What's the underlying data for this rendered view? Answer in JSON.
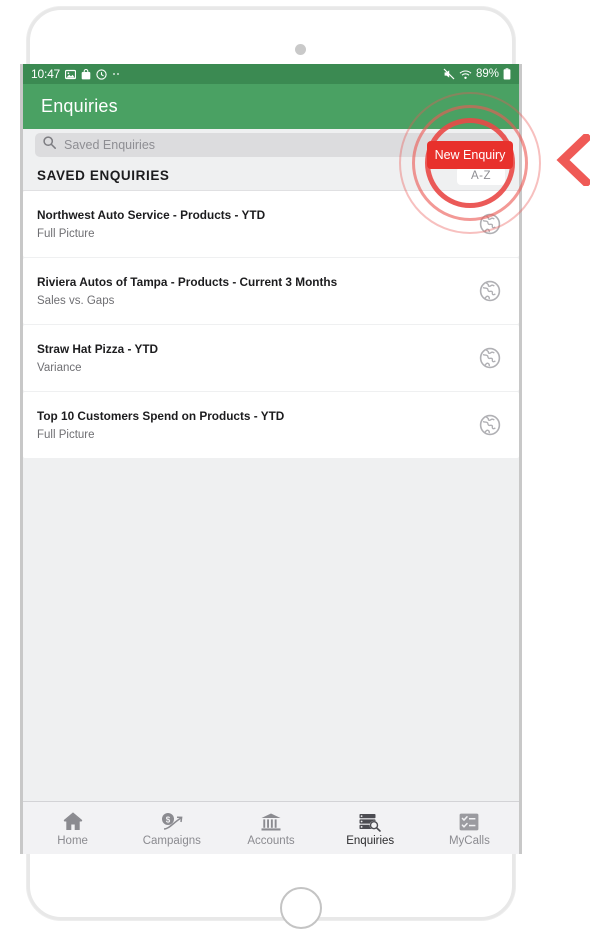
{
  "status_bar": {
    "time": "10:47",
    "left_icons": [
      "image-icon",
      "bag-icon",
      "clock-icon",
      "more-dots-icon"
    ],
    "mute_icon": "mute-icon",
    "wifi_icon": "wifi-icon",
    "battery_percent": "89%",
    "battery_icon": "battery-icon",
    "background_color": "#3b8a52"
  },
  "header": {
    "title": "Enquiries",
    "background_color": "#4aa163"
  },
  "search": {
    "placeholder": "Saved Enquiries",
    "value": "",
    "icon": "search-icon"
  },
  "section": {
    "title": "SAVED ENQUIRIES",
    "sort_label": "A-Z"
  },
  "callout": {
    "button_label": "New Enquiry",
    "button_color": "#e8312c",
    "ring_color": "#eb5a56",
    "arrow_icon": "chevron-left-icon"
  },
  "enquiries": [
    {
      "title": "Northwest Auto Service - Products - YTD",
      "subtitle": "Full Picture",
      "icon": "globe-icon"
    },
    {
      "title": "Riviera Autos of Tampa - Products - Current 3 Months",
      "subtitle": "Sales vs. Gaps",
      "icon": "globe-icon"
    },
    {
      "title": "Straw Hat Pizza - YTD",
      "subtitle": "Variance",
      "icon": "globe-icon"
    },
    {
      "title": "Top 10 Customers Spend on Products - YTD",
      "subtitle": "Full Picture",
      "icon": "globe-icon"
    }
  ],
  "tabs": [
    {
      "label": "Home",
      "icon": "home-icon",
      "active": false
    },
    {
      "label": "Campaigns",
      "icon": "campaign-growth-icon",
      "active": false
    },
    {
      "label": "Accounts",
      "icon": "bank-icon",
      "active": false
    },
    {
      "label": "Enquiries",
      "icon": "enquiries-search-icon",
      "active": true
    },
    {
      "label": "MyCalls",
      "icon": "checklist-icon",
      "active": false
    }
  ]
}
